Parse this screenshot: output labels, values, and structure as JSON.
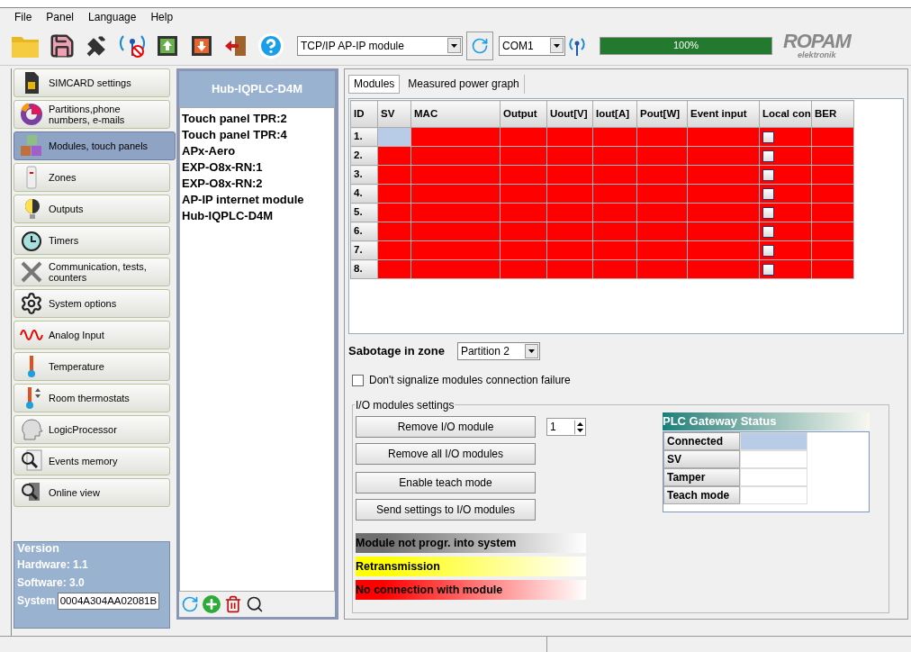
{
  "menu": [
    "File",
    "Panel",
    "Language",
    "Help"
  ],
  "toolbar": {
    "connection": "TCP/IP AP-IP module",
    "port": "COM1",
    "progress": {
      "level": 1.0,
      "reading": "100%"
    },
    "logo": {
      "name": "ROPAM",
      "subtitle": "elektronik"
    }
  },
  "sidebar": {
    "items": [
      {
        "label": "SIMCARD settings",
        "selected": false
      },
      {
        "label": "Partitions,phone numbers, e-mails",
        "selected": false
      },
      {
        "label": "Modules, touch panels",
        "selected": true
      },
      {
        "label": "Zones",
        "selected": false
      },
      {
        "label": "Outputs",
        "selected": false
      },
      {
        "label": "Timers",
        "selected": false
      },
      {
        "label": "Communication, tests, counters",
        "selected": false
      },
      {
        "label": "System options",
        "selected": false
      },
      {
        "label": "Analog Input",
        "selected": false
      },
      {
        "label": "Temperature",
        "selected": false
      },
      {
        "label": "Room thermostats",
        "selected": false
      },
      {
        "label": "LogicProcessor",
        "selected": false
      },
      {
        "label": "Events memory",
        "selected": false
      },
      {
        "label": "Online view",
        "selected": false
      }
    ],
    "version": {
      "title": "Version",
      "hardware": "Hardware: 1.1",
      "software": "Software: 3.0",
      "system_label": "System",
      "system_value": "0004A304AA02081B"
    }
  },
  "module_list": {
    "header": "Hub-IQPLC-D4M",
    "items": [
      "Touch panel TPR:2",
      "Touch panel TPR:4",
      "APx-Aero",
      "EXP-O8x-RN:1",
      "EXP-O8x-RN:2",
      "AP-IP internet module",
      "Hub-IQPLC-D4M"
    ]
  },
  "tabs": [
    {
      "label": "Modules",
      "selected": true
    },
    {
      "label": "Measured power graph",
      "selected": false
    }
  ],
  "table": {
    "columns": [
      "ID",
      "SV",
      "MAC",
      "Output",
      "Uout[V]",
      "Iout[A]",
      "Pout[W]",
      "Event input",
      "Local con",
      "BER"
    ],
    "rows": [
      {
        "id": "1.",
        "color": "#ff0000",
        "selected": true,
        "local_control": false
      },
      {
        "id": "2.",
        "color": "#ff0000",
        "selected": false,
        "local_control": false
      },
      {
        "id": "3.",
        "color": "#ff0000",
        "selected": false,
        "local_control": false
      },
      {
        "id": "4.",
        "color": "#ff0000",
        "selected": false,
        "local_control": false
      },
      {
        "id": "5.",
        "color": "#ff0000",
        "selected": false,
        "local_control": false
      },
      {
        "id": "6.",
        "color": "#ff0000",
        "selected": false,
        "local_control": false
      },
      {
        "id": "7.",
        "color": "#ff0000",
        "selected": false,
        "local_control": false
      },
      {
        "id": "8.",
        "color": "#ff0000",
        "selected": false,
        "local_control": false
      }
    ]
  },
  "sabotage": {
    "label": "Sabotage in zone",
    "value": "Partition 2"
  },
  "dont_signalize": {
    "label": "Don't signalize modules connection failure",
    "checked": false
  },
  "io_settings": {
    "title": "I/O modules settings",
    "buttons": [
      "Remove I/O module",
      "Remove all I/O modules",
      "Enable teach mode",
      "Send settings to I/O modules"
    ],
    "module_number": "1"
  },
  "legend": [
    {
      "label": "Module not progr. into system",
      "color": "#6e6e6e"
    },
    {
      "label": "Retransmission",
      "color": "#ffff00"
    },
    {
      "label": "No connection with module",
      "color": "#ff0000"
    }
  ],
  "plc_status": {
    "title": "PLC Gateway Status",
    "rows": [
      {
        "label": "Connected",
        "selected": true
      },
      {
        "label": "SV",
        "selected": false
      },
      {
        "label": "Tamper",
        "selected": false
      },
      {
        "label": "Teach mode",
        "selected": false
      }
    ]
  }
}
